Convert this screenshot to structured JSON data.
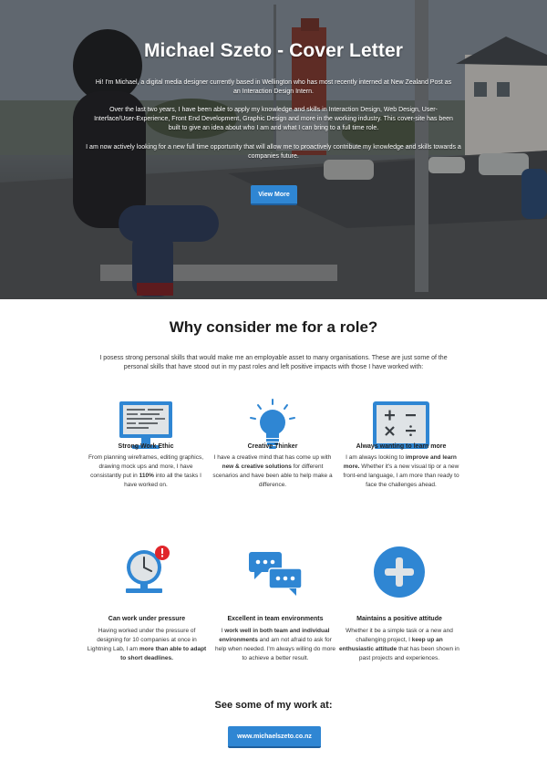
{
  "hero": {
    "title": "Michael Szeto - Cover Letter",
    "paragraph1": "Hi! I'm Michael, a digital media designer currently based in Wellington who has most recently interned at New Zealand Post as an Interaction Design Intern.",
    "paragraph2": "Over the last two years, I have been able to apply my knowledge and skills in Interaction Design, Web Design, User-Interface/User-Experience, Front End Development, Graphic Design and more in the working industry. This cover-site has been built to give an idea about who I am and what I can bring to a full time role.",
    "paragraph3": "I am now actively looking for a new full time opportunity that will allow me to proactively contribute my knowledge and skills towards a companies future.",
    "button_label": "View More"
  },
  "main": {
    "title": "Why consider me for a role?",
    "intro": "I posess strong personal skills that would make me an employable asset to many organisations. These are just some of the personal skills that have stood out in my past roles and left positive impacts with those I have worked with:",
    "features": [
      {
        "icon": "monitor-icon",
        "title": "Strong Work Ethic",
        "desc_parts": [
          "From planning wireframes, editing graphics, drawing mock ups and more, I have consistantly put in ",
          "110%",
          " into all the tasks I have worked on."
        ]
      },
      {
        "icon": "lightbulb-icon",
        "title": "Creative Thinker",
        "desc_parts": [
          "I have a creative mind that has come up with ",
          "new & creative solutions",
          " for different scenarios and have been able to help make a difference."
        ]
      },
      {
        "icon": "math-board-icon",
        "title": "Always wanting to learn more",
        "desc_parts": [
          "I am always looking to ",
          "improve and learn more.",
          " Whether it's a new visual tip or a new front-end language, I am more than ready to face the challenges ahead."
        ]
      },
      {
        "icon": "clock-alert-icon",
        "title": "Can work under pressure",
        "desc_parts": [
          "Having worked under the pressure of designing for 10 companies at once in Lightning Lab, I am ",
          "more than able to adapt to short deadlines."
        ]
      },
      {
        "icon": "chat-bubbles-icon",
        "title": "Excellent in team environments",
        "desc_parts": [
          "I ",
          "work well in both team and individual environments",
          " and am not afraid to ask for help when needed. I'm always willing do more to achieve a better result."
        ]
      },
      {
        "icon": "plus-circle-icon",
        "title": "Maintains a positive attitude",
        "desc_parts": [
          "Whether it be a simple task or a new and challenging project, I ",
          "keep up an enthusiastic attitude",
          " that has been shown in past projects and experiences."
        ]
      }
    ]
  },
  "work": {
    "title": "See some of my work at:",
    "link_label": "www.michaelszeto.co.nz"
  },
  "colors": {
    "accent": "#2f86d3",
    "icon_blue": "#2f86d3",
    "alert_red": "#e0262b"
  }
}
